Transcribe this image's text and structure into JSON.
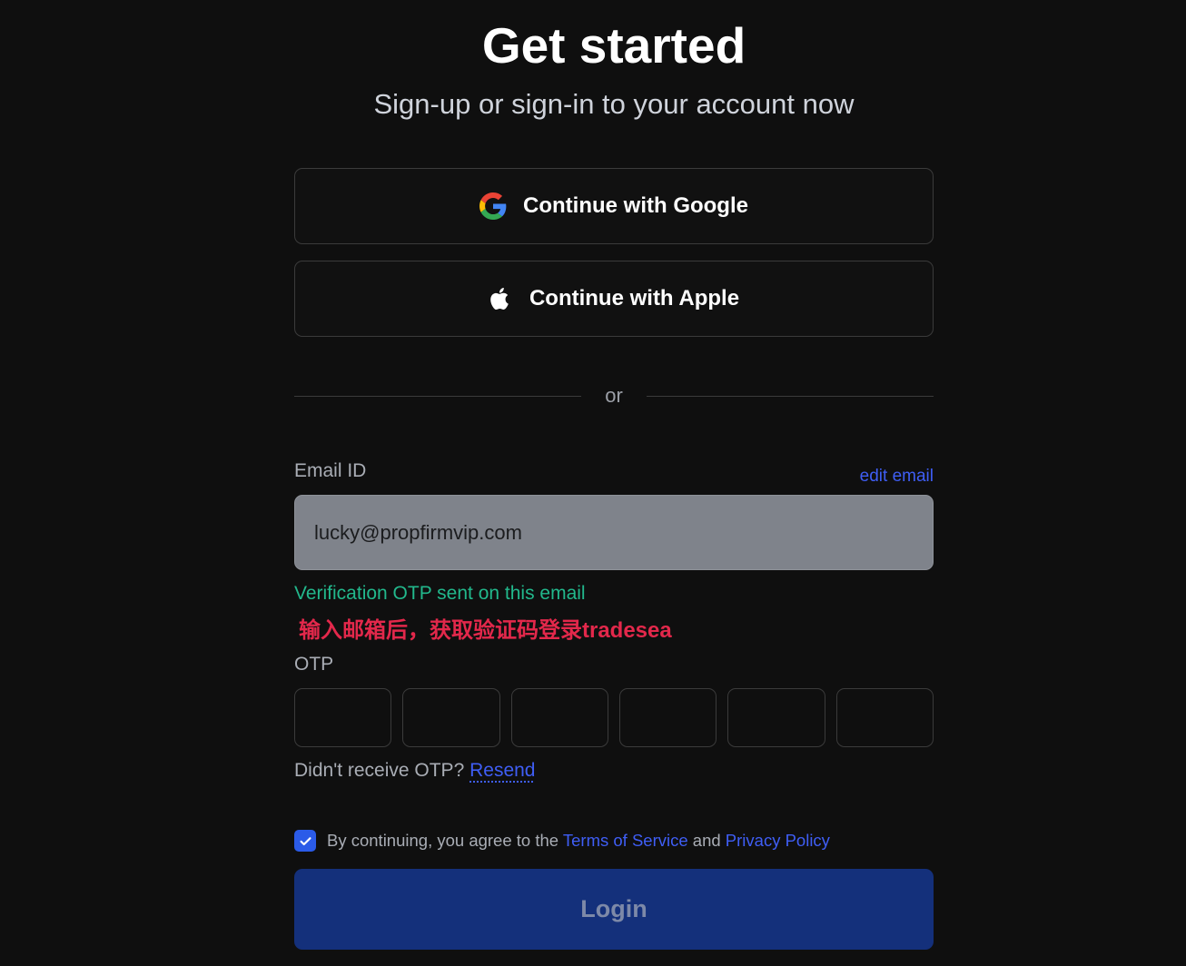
{
  "header": {
    "title": "Get started",
    "subtitle": "Sign-up or sign-in to your account now"
  },
  "social": {
    "google_label": "Continue with Google",
    "google_icon": "google-icon",
    "apple_label": "Continue with Apple",
    "apple_icon": "apple-icon"
  },
  "divider": {
    "label": "or"
  },
  "email": {
    "label": "Email ID",
    "edit_label": "edit email",
    "value": "lucky@propfirmvip.com",
    "status_message": "Verification OTP sent on this email"
  },
  "annotation": {
    "text": "输入邮箱后，获取验证码登录tradesea"
  },
  "otp": {
    "label": "OTP",
    "values": [
      "",
      "",
      "",
      "",
      "",
      ""
    ],
    "resend_prompt": "Didn't receive OTP?",
    "resend_label": "Resend"
  },
  "consent": {
    "checked": true,
    "check_icon": "check-icon",
    "prefix": "By continuing, you agree to the",
    "terms_label": "Terms of Service",
    "conjunction": "and",
    "privacy_label": "Privacy Policy"
  },
  "login": {
    "label": "Login"
  },
  "colors": {
    "accent": "#2b5be8",
    "link": "#3f5ef5",
    "success": "#22b88c",
    "annotation": "#e3284b",
    "primary_button": "#14307b",
    "primary_button_text": "#7d89a8"
  }
}
